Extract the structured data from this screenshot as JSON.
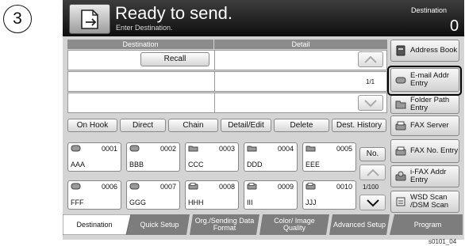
{
  "step_number": "3",
  "header": {
    "title": "Ready to send.",
    "subtitle": "Enter Destination.",
    "destination_label": "Destination",
    "destination_count": "0"
  },
  "table": {
    "col_destination": "Destination",
    "col_detail": "Detail",
    "recall_label": "Recall",
    "page_indicator": "1/1"
  },
  "actions": {
    "on_hook": "On Hook",
    "direct": "Direct",
    "chain": "Chain",
    "detail_edit": "Detail/Edit",
    "delete": "Delete",
    "dest_history": "Dest. History"
  },
  "side_buttons": [
    {
      "label": "Address Book",
      "icon": "address-book-icon"
    },
    {
      "label": "E-mail Addr Entry",
      "icon": "email-icon"
    },
    {
      "label": "Folder Path Entry",
      "icon": "folder-icon"
    },
    {
      "label": "FAX Server",
      "icon": "fax-server-icon"
    },
    {
      "label": "FAX No. Entry",
      "icon": "fax-icon"
    },
    {
      "label": "i-FAX Addr Entry",
      "icon": "ifax-icon"
    },
    {
      "label": "WSD Scan /DSM Scan",
      "icon": "wsd-scan-icon"
    }
  ],
  "one_touch": {
    "row1": [
      {
        "num": "0001",
        "name": "AAA",
        "icon": "email-icon"
      },
      {
        "num": "0002",
        "name": "BBB",
        "icon": "email-icon"
      },
      {
        "num": "0003",
        "name": "CCC",
        "icon": "folder-icon"
      },
      {
        "num": "0004",
        "name": "DDD",
        "icon": "folder-icon"
      },
      {
        "num": "0005",
        "name": "EEE",
        "icon": "folder-icon"
      }
    ],
    "row2": [
      {
        "num": "0006",
        "name": "FFF",
        "icon": "email-icon"
      },
      {
        "num": "0007",
        "name": "GGG",
        "icon": "email-icon"
      },
      {
        "num": "0008",
        "name": "HHH",
        "icon": "fax-icon"
      },
      {
        "num": "0009",
        "name": "III",
        "icon": "fax-icon"
      },
      {
        "num": "0010",
        "name": "JJJ",
        "icon": "fax-icon"
      }
    ],
    "no_label": "No.",
    "page_indicator": "1/100"
  },
  "tabs": [
    {
      "label": "Destination"
    },
    {
      "label": "Quick Setup"
    },
    {
      "label": "Org./Sending Data Format"
    },
    {
      "label": "Color/ Image Quality"
    },
    {
      "label": "Advanced Setup"
    },
    {
      "label": "Program"
    }
  ],
  "image_code": "s0101_04",
  "colors": {
    "accent_highlight": "#000000",
    "tab_active": "#ffffff",
    "tab_inactive": "#7d7d7d"
  }
}
